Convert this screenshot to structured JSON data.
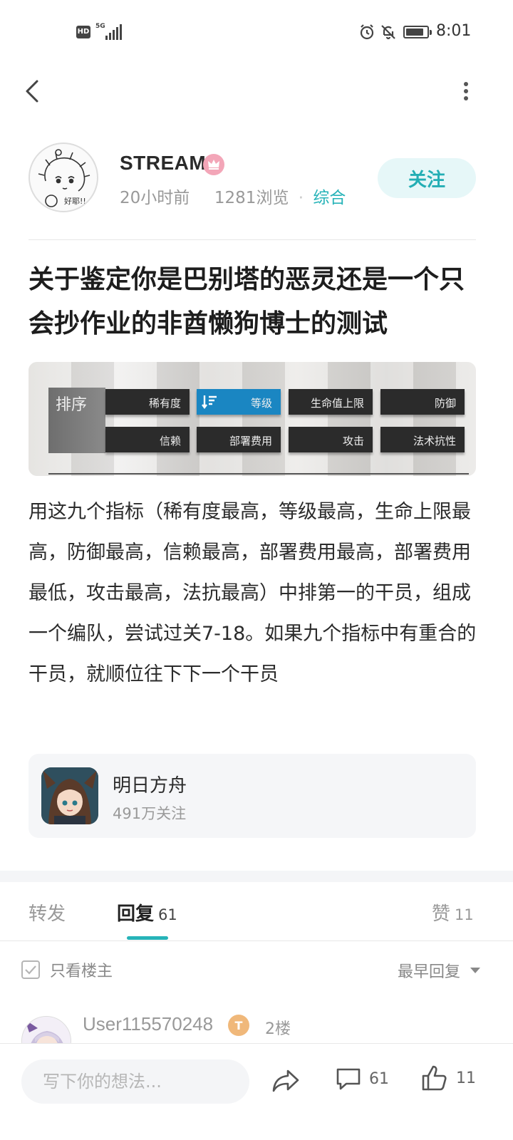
{
  "status_bar": {
    "hd": "HD",
    "network": "5G",
    "time": "8:01"
  },
  "author": {
    "name": "STREAM",
    "time_ago": "20小时前",
    "views": "1281浏览",
    "category": "综合",
    "follow_label": "关注"
  },
  "post": {
    "title": "关于鉴定你是巴别塔的恶灵还是一个只会抄作业的非酋懒狗博士的测试",
    "body": "用这九个指标（稀有度最高，等级最高，生命上限最高，防御最高，信赖最高，部署费用最高，部署费用最低，攻击最高，法抗最高）中排第一的干员，组成一个编队，尝试过关7-18。如果九个指标中有重合的干员，就顺位往下下一个干员",
    "image": {
      "sort_label": "排序",
      "buttons": [
        "稀有度",
        "等级",
        "生命值上限",
        "防御",
        "信赖",
        "部署费用",
        "攻击",
        "法术抗性"
      ],
      "active_button": "等级"
    }
  },
  "topic": {
    "name": "明日方舟",
    "followers": "491万关注"
  },
  "tabs": {
    "repost": "转发",
    "reply": "回复",
    "reply_count": "61",
    "like": "赞",
    "like_count": "11"
  },
  "filter": {
    "only_op": "只看楼主",
    "sort": "最早回复"
  },
  "comment": {
    "user": "User115570248",
    "level_badge": "T",
    "floor": "2楼"
  },
  "bottom_bar": {
    "placeholder": "写下你的想法...",
    "reply_count": "61",
    "like_count": "11"
  },
  "colors": {
    "accent": "#26b3b8",
    "follow_bg": "#e6f7f8",
    "active_sort": "#1a86c2"
  }
}
